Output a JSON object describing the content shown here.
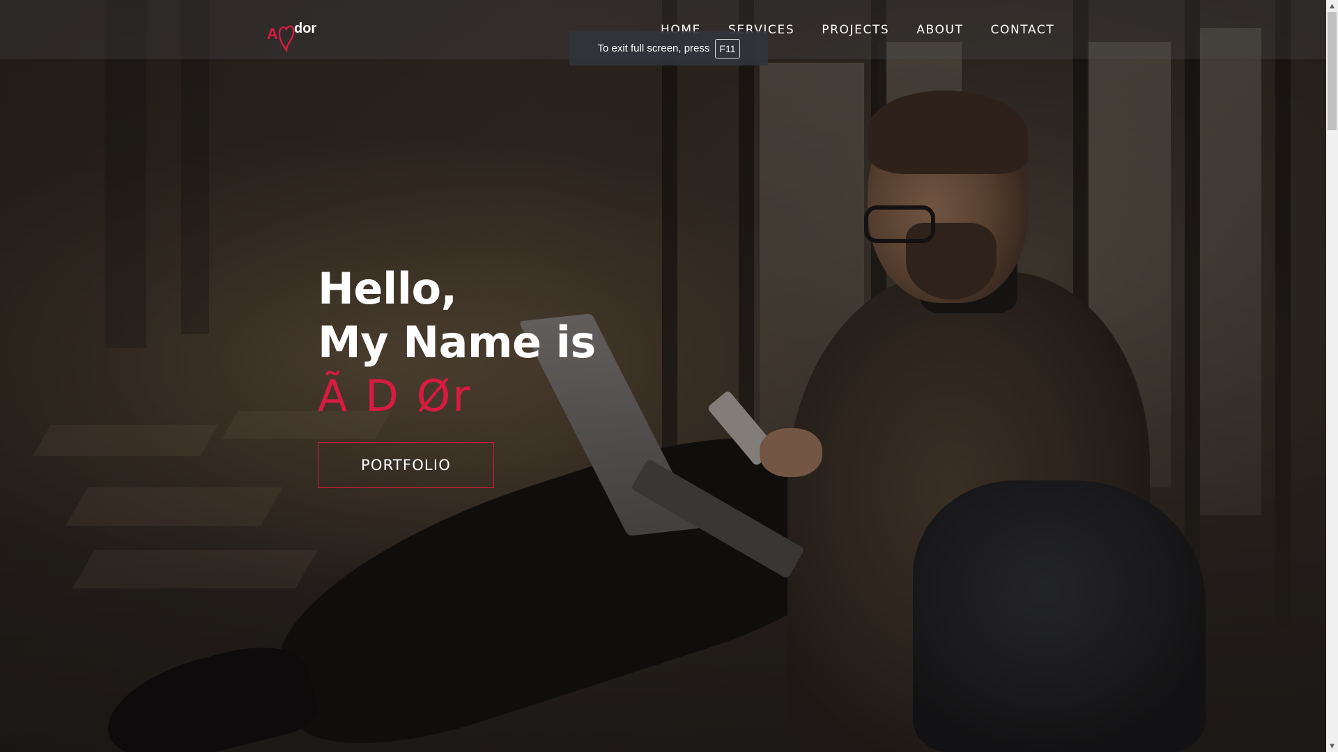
{
  "brand": {
    "logo_prefix": "A",
    "logo_suffix": "dor"
  },
  "nav": {
    "items": [
      {
        "label": "HOME"
      },
      {
        "label": "SERVICES"
      },
      {
        "label": "PROJECTS"
      },
      {
        "label": "ABOUT"
      },
      {
        "label": "CONTACT"
      }
    ]
  },
  "fullscreen_notice": {
    "text": "To exit full screen, press",
    "key": "F11"
  },
  "hero": {
    "greeting": "Hello,",
    "intro": "My Name is",
    "name": "Ã D Ør",
    "button_label": "PORTFOLIO"
  },
  "colors": {
    "accent": "#d81b40",
    "text": "#ffffff"
  },
  "icons": {
    "logo_mark": "heart-icon",
    "scroll_up": "scroll-up-arrow-icon",
    "scroll_down": "scroll-down-arrow-icon"
  }
}
